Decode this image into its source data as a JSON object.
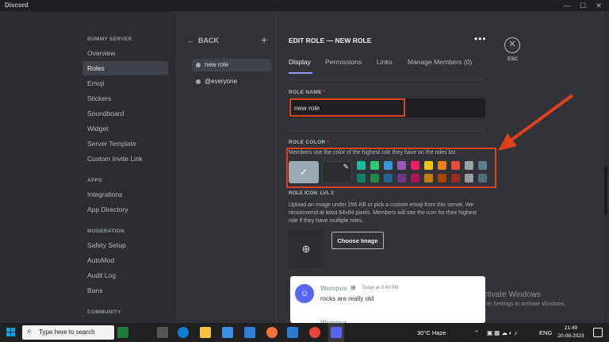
{
  "window": {
    "title": "Discord",
    "minimize": "—",
    "maximize": "☐",
    "close": "✕"
  },
  "sidebar": {
    "server_name": "DUMMY SERVER",
    "items": [
      {
        "label": "Overview"
      },
      {
        "label": "Roles"
      },
      {
        "label": "Emoji"
      },
      {
        "label": "Stickers"
      },
      {
        "label": "Soundboard"
      },
      {
        "label": "Widget"
      },
      {
        "label": "Server Template"
      },
      {
        "label": "Custom Invite Link"
      }
    ],
    "apps_header": "APPS",
    "apps_items": [
      {
        "label": "Integrations"
      },
      {
        "label": "App Directory"
      }
    ],
    "moderation_header": "MODERATION",
    "moderation_items": [
      {
        "label": "Safety Setup"
      },
      {
        "label": "AutoMod"
      },
      {
        "label": "Audit Log"
      },
      {
        "label": "Bans"
      }
    ],
    "community_header": "COMMUNITY"
  },
  "roles_panel": {
    "back_label": "BACK",
    "add_icon": "+",
    "roles": [
      {
        "label": "new role"
      },
      {
        "label": "@everyone"
      }
    ]
  },
  "editor": {
    "title": "EDIT ROLE — NEW ROLE",
    "more_icon": "•••",
    "esc_icon": "✕",
    "esc_label": "ESC",
    "tabs": [
      {
        "label": "Display"
      },
      {
        "label": "Permissions"
      },
      {
        "label": "Links"
      },
      {
        "label": "Manage Members (0)"
      }
    ],
    "role_name_label": "ROLE NAME",
    "required_mark": "*",
    "role_name_value": "new role",
    "role_color_label": "ROLE COLOR",
    "role_color_hint": "Members use the color of the highest role they have on the roles list.",
    "default_check": "✓",
    "picker_icon": "✎",
    "swatches_row1": [
      "#1abc9c",
      "#2ecc71",
      "#3498db",
      "#9b59b6",
      "#e91e63",
      "#f1c40f",
      "#e67e22",
      "#e74c3c",
      "#95a5a6",
      "#607d8b"
    ],
    "swatches_row2": [
      "#11806a",
      "#1f8b4c",
      "#206694",
      "#71368a",
      "#ad1457",
      "#c27c0e",
      "#a84300",
      "#992d22",
      "#979c9f",
      "#546e7a"
    ],
    "role_icon_label": "ROLE ICON",
    "role_icon_level": "LVL 2",
    "upload_text": "Upload an image under 256 KB or pick a custom emoji from this server. We recommend at least 64x64 pixels. Members will see the icon for their highest role if they have multiple roles.",
    "upload_icon": "⊕",
    "choose_image": "Choose Image"
  },
  "preview": {
    "name": "Wumpus",
    "time": "Today at 9:49 PM",
    "message": "rocks are really old",
    "next_name": "Wumpus"
  },
  "watermark": {
    "line1": "Activate Windows",
    "line2": "Go to Settings to activate Windows."
  },
  "taskbar": {
    "search_placeholder": "Type here to search",
    "weather": "30°C  Haze",
    "lang": "ENG",
    "time": "21:49",
    "date": "20-08-2023"
  }
}
